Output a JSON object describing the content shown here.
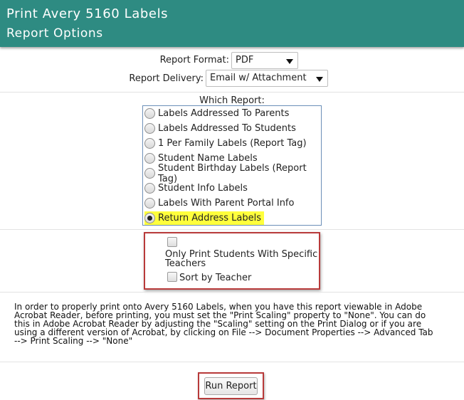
{
  "header": {
    "title": "Print Avery 5160 Labels",
    "subtitle": "Report Options"
  },
  "format": {
    "label": "Report Format:",
    "value": "PDF"
  },
  "delivery": {
    "label": "Report Delivery:",
    "value": "Email w/ Attachment"
  },
  "which_report": {
    "title": "Which Report:",
    "options": [
      {
        "label": "Labels Addressed To Parents",
        "selected": false
      },
      {
        "label": "Labels Addressed To Students",
        "selected": false
      },
      {
        "label": "1 Per Family Labels (Report Tag)",
        "selected": false
      },
      {
        "label": "Student Name Labels",
        "selected": false
      },
      {
        "label": "Student Birthday Labels (Report Tag)",
        "selected": false
      },
      {
        "label": "Student Info Labels",
        "selected": false
      },
      {
        "label": "Labels With Parent Portal Info",
        "selected": false
      },
      {
        "label": "Return Address Labels",
        "selected": true
      }
    ]
  },
  "teacher_options": {
    "specific_teachers_label_line1": "Only Print Students With Specific",
    "specific_teachers_label_line2": "Teachers",
    "specific_teachers_checked": false,
    "sort_by_teacher_label": "Sort by Teacher",
    "sort_by_teacher_checked": false
  },
  "note": {
    "line1": "In order to properly print onto Avery 5160 Labels, when you have this report viewable in Adobe",
    "line2": "Acrobat Reader, before printing, you must set the \"Print Scaling\" property to \"None\". You can do",
    "line3": "this in Adobe Acrobat Reader by adjusting the \"Scaling\" setting on the Print Dialog or if you are",
    "line4": "using a different version of Acrobat, by clicking on File --> Document Properties --> Advanced Tab",
    "line5": "--> Print Scaling --> \"None\""
  },
  "actions": {
    "run_label": "Run Report"
  },
  "colors": {
    "header_bg": "#2e8b82",
    "highlight": "#ffff3c",
    "outline_red": "#b83a3a"
  }
}
